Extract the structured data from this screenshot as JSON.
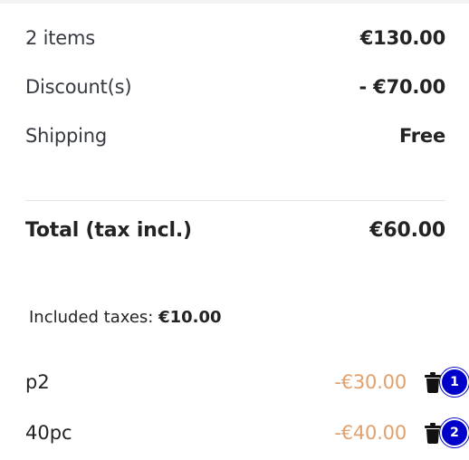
{
  "summary": {
    "items_label": "2 items",
    "items_value": "€130.00",
    "discount_label": "Discount(s)",
    "discount_value": "- €70.00",
    "shipping_label": "Shipping",
    "shipping_value": "Free"
  },
  "total": {
    "label": "Total (tax incl.)",
    "value": "€60.00"
  },
  "taxes": {
    "label": "Included taxes:",
    "value": "€10.00"
  },
  "vouchers": [
    {
      "name": "p2",
      "amount": "-€30.00",
      "badge": "1"
    },
    {
      "name": "40pc",
      "amount": "-€40.00",
      "badge": "2"
    }
  ],
  "colors": {
    "voucher_amount": "#e2a06c",
    "badge": "#0000c8",
    "text": "#232323"
  },
  "icons": {
    "remove": "trash-icon"
  }
}
